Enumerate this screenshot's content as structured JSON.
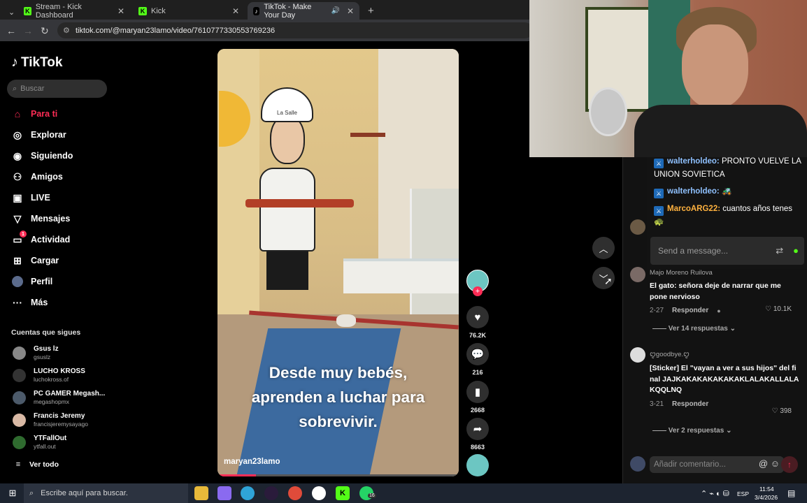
{
  "browser": {
    "tabs": [
      {
        "label": "Stream - Kick Dashboard",
        "icon": "kick-icon"
      },
      {
        "label": "Kick",
        "icon": "kick-icon"
      },
      {
        "label": "TikTok - Make Your Day",
        "icon": "tiktok-icon"
      }
    ],
    "url": "tiktok.com/@maryan23lamo/video/7610777330553769236"
  },
  "sidebar": {
    "logo": "TikTok",
    "search_placeholder": "Buscar",
    "nav": [
      {
        "label": "Para ti",
        "icon": "home-icon"
      },
      {
        "label": "Explorar",
        "icon": "compass-icon"
      },
      {
        "label": "Siguiendo",
        "icon": "following-icon"
      },
      {
        "label": "Amigos",
        "icon": "friends-icon"
      },
      {
        "label": "LIVE",
        "icon": "live-icon"
      },
      {
        "label": "Mensajes",
        "icon": "send-icon"
      },
      {
        "label": "Actividad",
        "icon": "activity-icon",
        "badge": "1"
      },
      {
        "label": "Cargar",
        "icon": "upload-icon"
      },
      {
        "label": "Perfil",
        "icon": "profile-icon"
      },
      {
        "label": "Más",
        "icon": "more-icon"
      }
    ],
    "following_title": "Cuentas que sigues",
    "following": [
      {
        "name": "Gsus lz",
        "handle": "gsuslz"
      },
      {
        "name": "LUCHO KROSS",
        "handle": "luchokross.of"
      },
      {
        "name": "PC GAMER Megash...",
        "handle": "megashopmx"
      },
      {
        "name": "Francis Jeremy",
        "handle": "francisjeremysayago"
      },
      {
        "name": "YTFallOut",
        "handle": "ytfall.out"
      }
    ],
    "see_all": "Ver todo"
  },
  "video": {
    "caption_lines": [
      "Desde muy bebés,",
      "aprenden a luchar para",
      "sobrevivir."
    ],
    "username": "maryan23lamo",
    "progress": 0.16,
    "sign_text": "La Salle"
  },
  "actions": {
    "likes": "76.2K",
    "comments": "216",
    "saves": "2668",
    "shares": "8663"
  },
  "comments": [
    {
      "name": "Majo Moreno Ruilova",
      "text": "El gato: señora deje de narrar que me pone nervioso",
      "date": "2-27",
      "reply": "Responder",
      "likes": "10.1K",
      "replies": "Ver 14 respuestas"
    },
    {
      "name": "ꨄgoodbye.ꨄ",
      "text": "[Sticker] El \"vayan a ver a sus hijos\" del final JAJKAKAKAKAKAKAKLALAKALLALAKQQLNQ",
      "date": "3-21",
      "reply": "Responder",
      "likes": "398",
      "replies": "Ver 2 respuestas"
    }
  ],
  "add_comment_placeholder": "Añadir comentario...",
  "stream_chat": {
    "messages": [
      {
        "user": "walterholdeo:",
        "text": "PRONTO VUELVE LA UNION SOVIETICA",
        "color": "#8fc1ff"
      },
      {
        "user": "walterholdeo:",
        "text": "🚜",
        "color": "#8fc1ff"
      },
      {
        "user": "MarcoARG22:",
        "text": "cuantos años tenes 🐢",
        "color": "#ffb23f"
      }
    ],
    "input_placeholder": "Send a message..."
  },
  "taskbar": {
    "search_placeholder": "Escribe aquí para buscar.",
    "language": "ESP",
    "time": "11:54",
    "date": "3/4/2026",
    "whatsapp_badge": "16"
  },
  "colors": {
    "accent": "#fe2c55",
    "kick": "#53fc18"
  }
}
